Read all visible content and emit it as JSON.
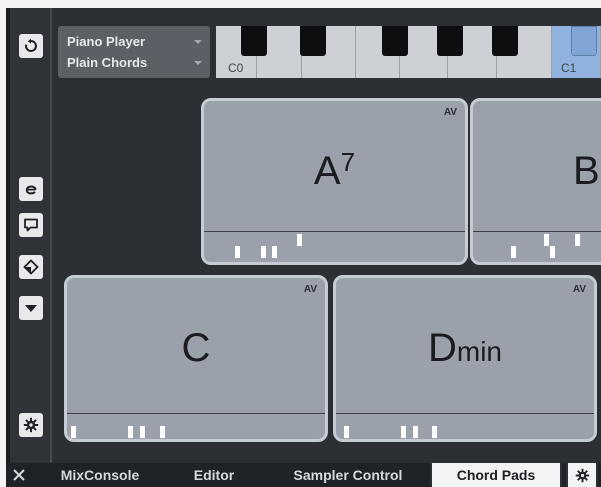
{
  "player": {
    "name": "Piano Player",
    "style": "Plain Chords"
  },
  "keyboard": {
    "labels": [
      "C0",
      "C1"
    ]
  },
  "pads": [
    {
      "root": "A",
      "sup": "7",
      "suffix": "",
      "badge": "AV"
    },
    {
      "root": "B",
      "sup": "",
      "suffix": "",
      "badge": ""
    },
    {
      "root": "C",
      "sup": "",
      "suffix": "",
      "badge": "AV"
    },
    {
      "root": "D",
      "sup": "",
      "suffix": "min",
      "badge": "AV"
    }
  ],
  "tabs": {
    "mixconsole": "MixConsole",
    "editor": "Editor",
    "sampler": "Sampler Control",
    "chordpads": "Chord Pads"
  },
  "icons": {
    "toolbar": [
      "reset-icon",
      "edit-icon",
      "comment-icon",
      "tag-icon",
      "chevron-down-icon",
      "gear-icon"
    ],
    "close": "close-icon",
    "settings": "gear-icon"
  },
  "colors": {
    "background": "#2c3035",
    "pad": "#9aa1ab",
    "pad_border": "#c6ccd3",
    "active_key": "#8fb3dd",
    "active_tab": "#f2f3f5"
  }
}
